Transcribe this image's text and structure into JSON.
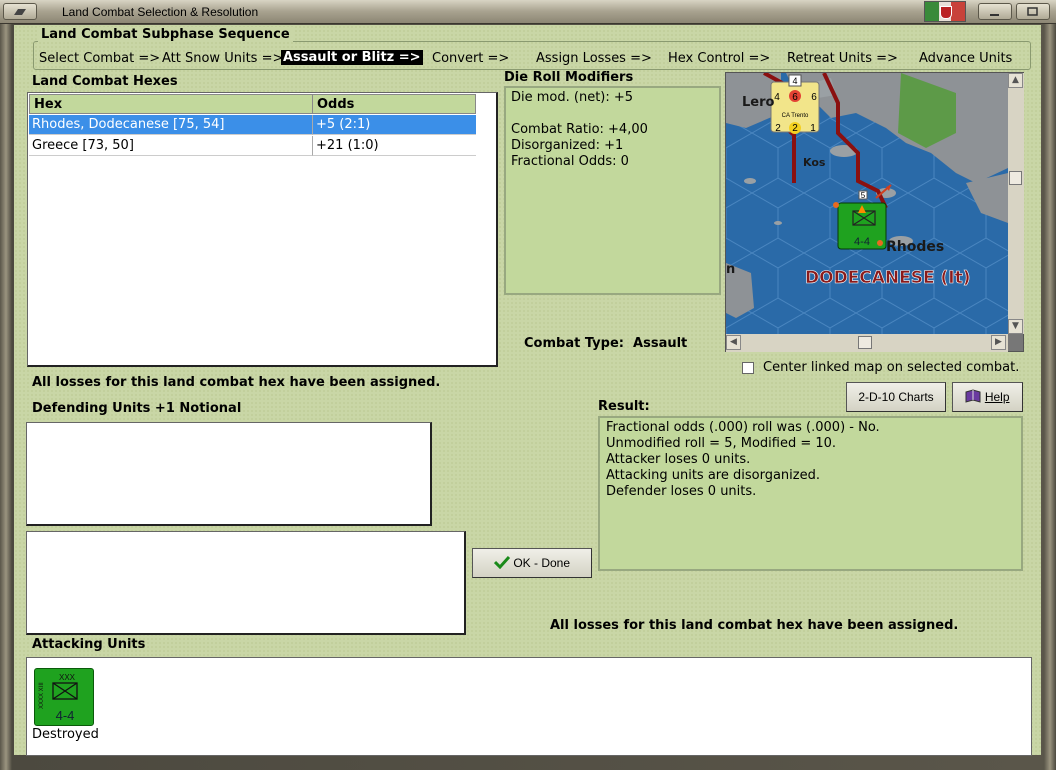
{
  "window": {
    "title": "Land Combat Selection & Resolution"
  },
  "sequence": {
    "title": "Land Combat Subphase Sequence",
    "steps": [
      "Select Combat =>",
      "Att Snow Units =>",
      "Assault or Blitz =>",
      "Convert =>",
      "Assign Losses =>",
      "Hex Control =>",
      "Retreat Units =>",
      "Advance Units"
    ],
    "active_step": "Assault or Blitz =>"
  },
  "hexes": {
    "title": "Land Combat Hexes",
    "columns": [
      "Hex",
      "Odds"
    ],
    "rows": [
      {
        "hex": "Rhodes, Dodecanese [75, 54]",
        "odds": "+5 (2:1)",
        "selected": true
      },
      {
        "hex": "Greece [73, 50]",
        "odds": "+21 (1:0)",
        "selected": false
      }
    ]
  },
  "die_roll_modifiers": {
    "title": "Die Roll Modifiers",
    "lines": [
      "Die mod. (net): +5",
      "",
      "Combat Ratio: +4,00",
      "Disorganized: +1",
      "Fractional Odds: 0"
    ]
  },
  "map": {
    "labels": {
      "lero": "Lero",
      "kos": "Kos",
      "rhodes": "Rhodes",
      "dodecanese": "DODECANESE (It)",
      "edge_n": "n"
    },
    "naval_counter": {
      "stack": "4",
      "name": "CA Trento",
      "top": [
        "4",
        "6",
        "6"
      ],
      "bottom": [
        "2",
        "2",
        "1"
      ]
    },
    "land_counter": {
      "stack": "5",
      "strength": "4-4",
      "id": "XXXX XIII"
    }
  },
  "combat_type": {
    "label": "Combat Type:",
    "value": "Assault"
  },
  "center_map": {
    "label": "Center linked map on selected combat.",
    "checked": false
  },
  "buttons": {
    "charts": "2-D-10 Charts",
    "help": "Help",
    "ok": "OK - Done"
  },
  "messages": {
    "losses_assigned_top": "All losses for this land combat hex have been assigned.",
    "losses_assigned_bottom": "All losses for this land combat hex have been assigned."
  },
  "defending": {
    "title": "Defending Units +1 Notional"
  },
  "result": {
    "title": "Result:",
    "lines": [
      "Fractional odds (.000) roll was (.000)  - No.",
      "Unmodified roll = 5, Modified = 10.",
      "Attacker loses 0 units.",
      "Attacking units are disorganized.",
      "Defender loses 0 units."
    ]
  },
  "attacking": {
    "title": "Attacking Units",
    "units": [
      {
        "strength": "4-4",
        "size": "XXX",
        "id": "XXXX XIII",
        "status": "Destroyed"
      }
    ]
  },
  "colors": {
    "panel": "#c9d6a6",
    "selection": "#3b8fe8",
    "unit_green": "#1fa21f",
    "sea": "#2a6aa8",
    "border_red": "#8a1010"
  }
}
